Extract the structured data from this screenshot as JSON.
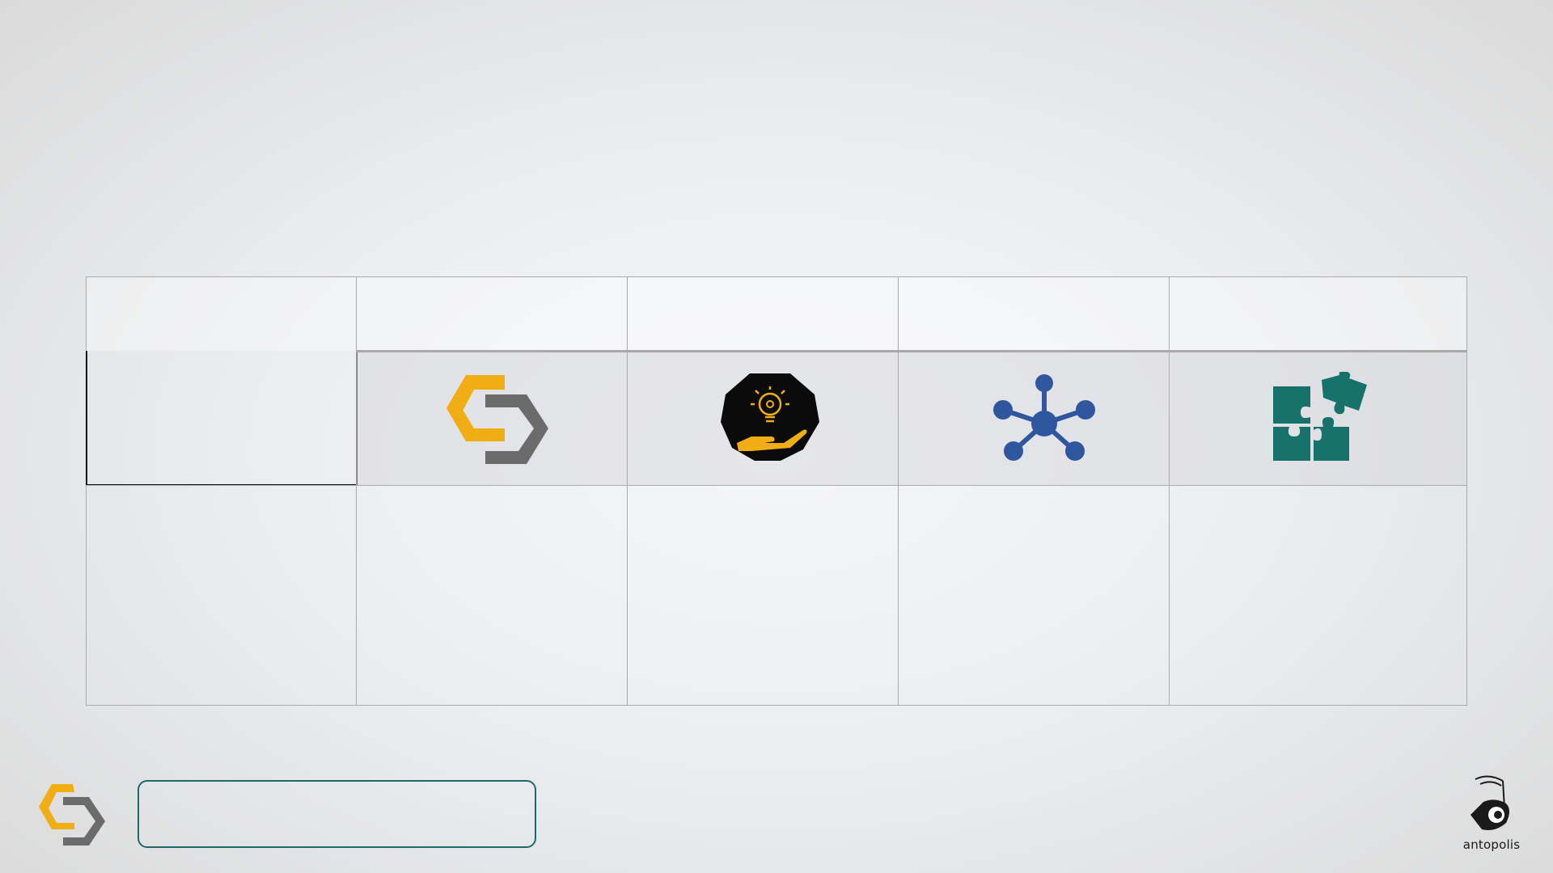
{
  "slide": {
    "columns": [
      {
        "icon": "hexagon-c-logo-icon"
      },
      {
        "icon": "hand-lightbulb-icon"
      },
      {
        "icon": "network-nodes-icon"
      },
      {
        "icon": "puzzle-pieces-icon"
      }
    ],
    "bottom_box_text": "",
    "footer_logo_icon": "hexagon-c-logo-icon",
    "watermark_logo_icon": "antopolis-ant-icon",
    "watermark_text": "antopolis"
  },
  "colors": {
    "gold": "#f0ad14",
    "gray": "#6b6b6b",
    "teal": "#17726b",
    "navy": "#2e57a0",
    "black": "#0b0b0b",
    "border_teal": "#1c6b6a"
  }
}
